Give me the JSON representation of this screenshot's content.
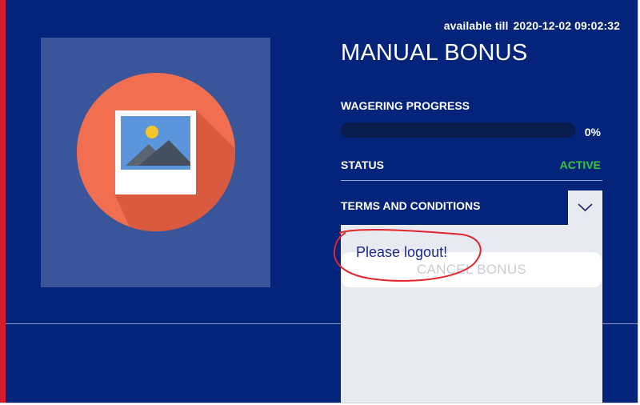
{
  "bonus": {
    "available_label": "available till",
    "available_date": "2020-12-02 09:02:32",
    "title": "MANUAL BONUS",
    "wagering_label": "WAGERING PROGRESS",
    "wagering_progress": 0,
    "wagering_percent": "0%",
    "status_label": "STATUS",
    "status_value": "ACTIVE",
    "terms_label": "TERMS AND CONDITIONS",
    "cancel_label": "CANCEL BONUS"
  },
  "annotation": {
    "text": "Please logout!"
  },
  "colors": {
    "background": "#03247a",
    "accent": "#d41c2c",
    "active": "#2fcc3a",
    "annotation": "#e0262d"
  },
  "icons": {
    "thumbnail": "image-placeholder-icon",
    "toggle": "chevron-down-icon"
  }
}
